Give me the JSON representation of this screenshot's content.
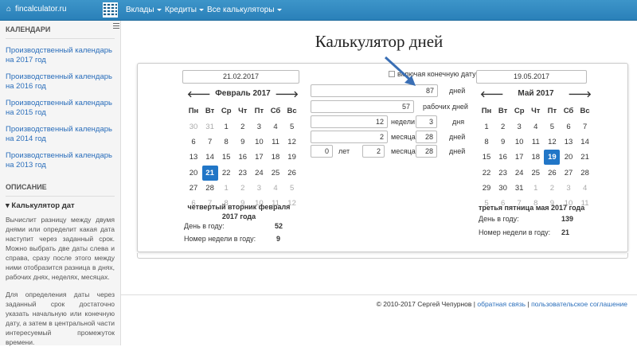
{
  "topbar": {
    "brand": "fincalculator.ru",
    "nav": [
      "Вклады",
      "Кредиты",
      "Все калькуляторы"
    ]
  },
  "sidebar": {
    "section1": "КАЛЕНДАРИ",
    "links": [
      "Производственный календарь на 2017 год",
      "Производственный календарь на 2016 год",
      "Производственный календарь на 2015 год",
      "Производственный календарь на 2014 год",
      "Производственный календарь на 2013 год"
    ],
    "section2": "ОПИСАНИЕ",
    "sub": "▾ Калькулятор дат",
    "p1": "Вычислит разницу между двумя днями или определит какая дата наступит через заданный срок. Можно выбрать две даты слева и справа, сразу после этого между ними отобразится разница в днях, рабочих днях, неделях, месяцах.",
    "p2": "Для определения даты через заданный срок достаточно указать начальную или конечную дату, а затем в центральной части интересуемый промежуток времени."
  },
  "title": "Калькулятор дней",
  "left": {
    "date": "21.02.2017",
    "month": "Февраль 2017",
    "desc": "четвертый вторник февраля 2017 года",
    "dayLabel": "День в году:",
    "day": "52",
    "weekLabel": "Номер недели в году:",
    "week": "9"
  },
  "right": {
    "date": "19.05.2017",
    "month": "Май 2017",
    "desc": "третья пятница мая 2017 года",
    "dayLabel": "День в году:",
    "day": "139",
    "weekLabel": "Номер недели в году:",
    "week": "21"
  },
  "weekdays": [
    "Пн",
    "Вт",
    "Ср",
    "Чт",
    "Пт",
    "Сб",
    "Вс"
  ],
  "middle": {
    "checkbox": "включая конечную дату",
    "days": "87",
    "daysLbl": "дней",
    "work": "57",
    "workLbl": "рабочих дней",
    "weeks": "12",
    "weeksLbl": "недели",
    "wdays": "3",
    "wdaysLbl": "дня",
    "months": "2",
    "monthsLbl": "месяца",
    "mdays": "28",
    "mdaysLbl": "дней",
    "years": "0",
    "yearsLbl": "лет",
    "ymonths": "2",
    "ymonthsLbl": "месяца",
    "ydays": "28",
    "ydaysLbl": "дней"
  },
  "footer": {
    "copy": "© 2010-2017 Сергей Чепурнов",
    "sep": "|",
    "link1": "обратная связь",
    "link2": "пользовательское соглашение"
  }
}
